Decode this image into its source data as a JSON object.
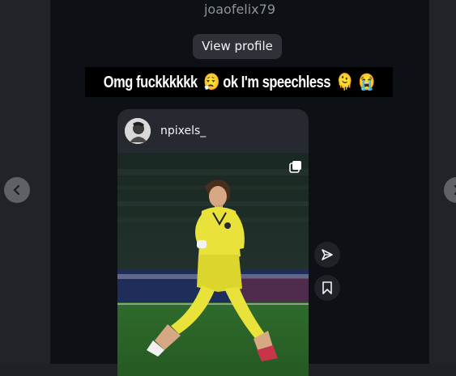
{
  "thread": {
    "username": "joaofelix79",
    "view_profile_label": "View profile"
  },
  "message": {
    "caption": "Omg fuckkkkkk",
    "caption_emoji_1": "😮‍💨",
    "caption_mid": "ok I'm speechless",
    "caption_emoji_2": "🫠",
    "caption_emoji_3": "😭"
  },
  "shared_post": {
    "author": "npixels_",
    "type_icon": "carousel-icon",
    "image_subject": "footballer-in-yellow-kit"
  },
  "actions": {
    "share_icon": "send-icon",
    "save_icon": "bookmark-icon"
  },
  "navigation": {
    "prev_icon": "chevron-left-icon",
    "next_icon": "chevron-right-icon"
  }
}
